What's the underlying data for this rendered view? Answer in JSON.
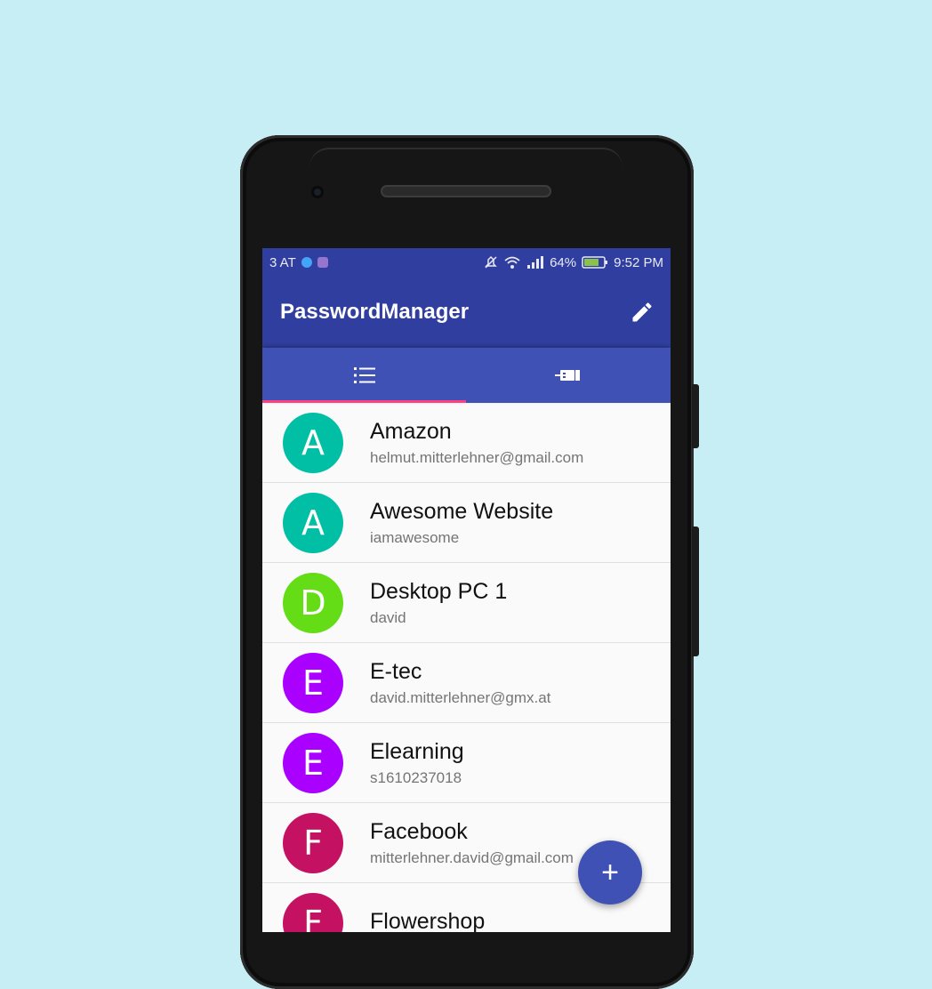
{
  "status_bar": {
    "carrier": "3 AT",
    "battery": "64%",
    "time": "9:52 PM"
  },
  "toolbar": {
    "title": "PasswordManager",
    "edit_icon": "pencil-icon"
  },
  "tabs": [
    {
      "icon": "list-icon",
      "selected": true
    },
    {
      "icon": "usb-drive-icon",
      "selected": false
    }
  ],
  "colors": {
    "primary_dark": "#303f9f",
    "primary": "#3f51b5",
    "accent": "#ff4081",
    "background": "#c8eef5"
  },
  "entries": [
    {
      "initial": "A",
      "name": "Amazon",
      "sub": "helmut.mitterlehner@gmail.com",
      "color": "#00bfa5"
    },
    {
      "initial": "A",
      "name": "Awesome Website",
      "sub": "iamawesome",
      "color": "#00bfa5"
    },
    {
      "initial": "D",
      "name": "Desktop PC 1",
      "sub": "david",
      "color": "#64dd17"
    },
    {
      "initial": "E",
      "name": "E-tec",
      "sub": "david.mitterlehner@gmx.at",
      "color": "#aa00ff"
    },
    {
      "initial": "E",
      "name": "Elearning",
      "sub": "s1610237018",
      "color": "#aa00ff"
    },
    {
      "initial": "F",
      "name": "Facebook",
      "sub": "mitterlehner.david@gmail.com",
      "color": "#c51162"
    },
    {
      "initial": "F",
      "name": "Flowershop",
      "sub": "",
      "color": "#c51162"
    }
  ],
  "fab": {
    "label": "+",
    "icon": "add-icon"
  }
}
